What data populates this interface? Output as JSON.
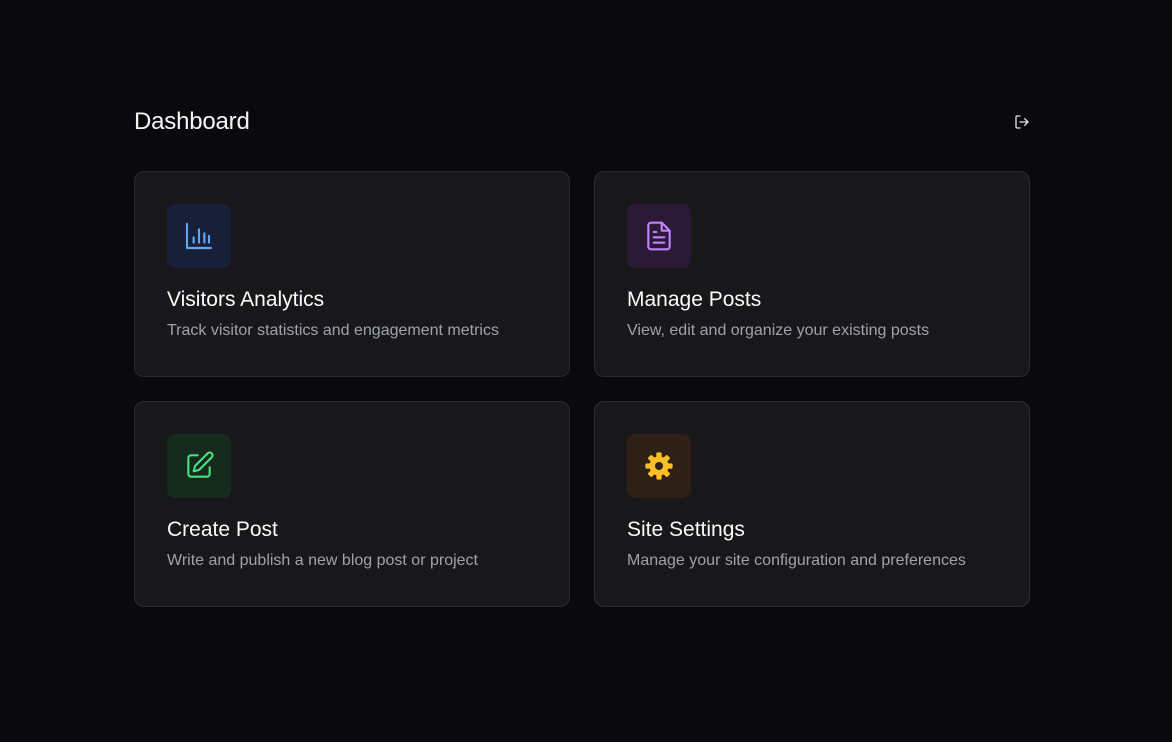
{
  "header": {
    "title": "Dashboard",
    "logout_icon": "logout-icon"
  },
  "cards": [
    {
      "title": "Visitors Analytics",
      "description": "Track visitor statistics and engagement metrics",
      "icon": "bar-chart-icon",
      "icon_color": "#60a5fa",
      "icon_bg": "#172036"
    },
    {
      "title": "Manage Posts",
      "description": "View, edit and organize your existing posts",
      "icon": "document-icon",
      "icon_color": "#c084fc",
      "icon_bg": "#2a1a35"
    },
    {
      "title": "Create Post",
      "description": "Write and publish a new blog post or project",
      "icon": "edit-icon",
      "icon_color": "#4ade80",
      "icon_bg": "#142a1c"
    },
    {
      "title": "Site Settings",
      "description": "Manage your site configuration and preferences",
      "icon": "gear-icon",
      "icon_color": "#fbbf24",
      "icon_bg": "#2e1f17"
    }
  ]
}
